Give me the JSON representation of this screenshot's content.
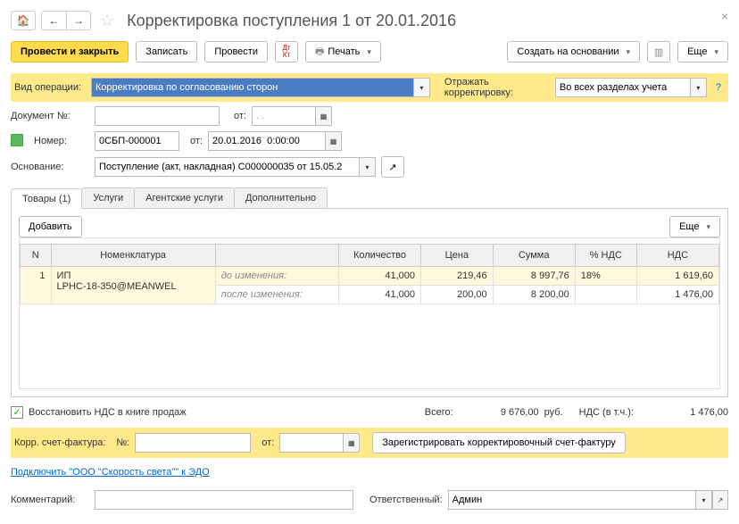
{
  "title": "Корректировка поступления 1 от 20.01.2016",
  "toolbar": {
    "post_close": "Провести и закрыть",
    "save": "Записать",
    "post": "Провести",
    "print": "Печать",
    "create_based": "Создать на основании",
    "more": "Еще"
  },
  "op": {
    "label": "Вид операции:",
    "value": "Корректировка по согласованию сторон",
    "reflect_label": "Отражать корректировку:",
    "reflect_value": "Во всех разделах учета"
  },
  "doc": {
    "num_label": "Документ №:",
    "num_value": "",
    "from_label": "от:",
    "from_value": ". .",
    "number_label": "Номер:",
    "number_value": "0СБП-000001",
    "date_label": "от:",
    "date_value": "20.01.2016  0:00:00",
    "basis_label": "Основание:",
    "basis_value": "Поступление (акт, накладная) С000000035 от 15.05.2"
  },
  "tabs": {
    "goods": "Товары (1)",
    "services": "Услуги",
    "agent": "Агентские услуги",
    "additional": "Дополнительно",
    "add_btn": "Добавить",
    "more": "Еще"
  },
  "cols": {
    "n": "N",
    "nomen": "Номенклатура",
    "qty": "Количество",
    "price": "Цена",
    "sum": "Сумма",
    "vat_pct": "% НДС",
    "vat": "НДС"
  },
  "rows": [
    {
      "n": "1",
      "name1": "ИП",
      "name2": "LPHC-18-350@MEANWEL",
      "before_label": "до изменения:",
      "after_label": "после изменения:",
      "before": {
        "qty": "41,000",
        "price": "219,46",
        "sum": "8 997,76",
        "vat_pct": "18%",
        "vat": "1 619,60"
      },
      "after": {
        "qty": "41,000",
        "price": "200,00",
        "sum": "8 200,00",
        "vat_pct": "",
        "vat": "1 476,00"
      }
    }
  ],
  "footer": {
    "restore_vat": "Восстановить НДС в книге продаж",
    "total_label": "Всего:",
    "total_value": "9 676,00",
    "total_cur": "руб.",
    "vat_label": "НДС (в т.ч.):",
    "vat_value": "1 476,00",
    "corr_label": "Корр. счет-фактура:",
    "corr_num_label": "№:",
    "corr_from_label": "от:",
    "reg_btn": "Зарегистрировать корректировочный счет-фактуру",
    "edo_link": "Подключить \"ООО \"Скорость света\"\" к ЭДО",
    "comment_label": "Комментарий:",
    "resp_label": "Ответственный:",
    "resp_value": "Админ"
  }
}
